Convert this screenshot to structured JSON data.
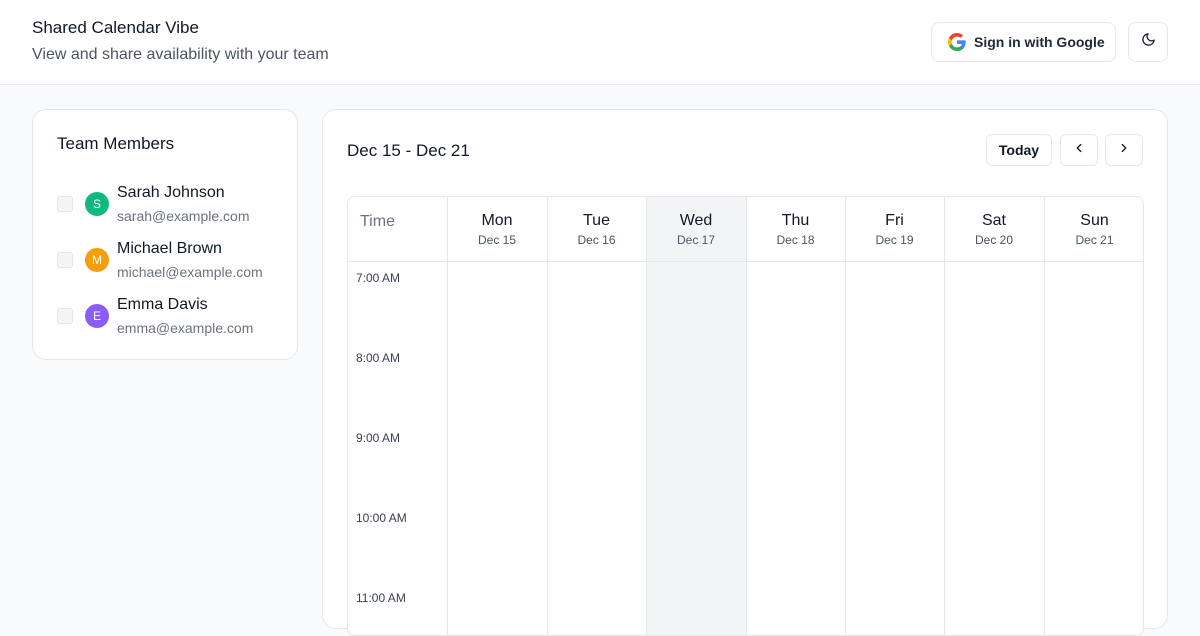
{
  "header": {
    "title": "Shared Calendar Vibe",
    "subtitle": "View and share availability with your team",
    "google_button": "Sign in with Google",
    "theme_icon": "moon-icon"
  },
  "team": {
    "title": "Team Members",
    "members": [
      {
        "initial": "S",
        "name": "Sarah Johnson",
        "email": "sarah@example.com",
        "color": "#10b981"
      },
      {
        "initial": "M",
        "name": "Michael Brown",
        "email": "michael@example.com",
        "color": "#f59e0b"
      },
      {
        "initial": "E",
        "name": "Emma Davis",
        "email": "emma@example.com",
        "color": "#8b5cf6"
      }
    ]
  },
  "calendar": {
    "range": "Dec 15 - Dec 21",
    "today_button": "Today",
    "time_header": "Time",
    "days": [
      {
        "name": "Mon",
        "date": "Dec 15"
      },
      {
        "name": "Tue",
        "date": "Dec 16"
      },
      {
        "name": "Wed",
        "date": "Dec 17"
      },
      {
        "name": "Thu",
        "date": "Dec 18"
      },
      {
        "name": "Fri",
        "date": "Dec 19"
      },
      {
        "name": "Sat",
        "date": "Dec 20"
      },
      {
        "name": "Sun",
        "date": "Dec 21"
      }
    ],
    "highlight_day": "Wed",
    "times": [
      "7:00 AM",
      "8:00 AM",
      "9:00 AM",
      "10:00 AM",
      "11:00 AM"
    ]
  }
}
